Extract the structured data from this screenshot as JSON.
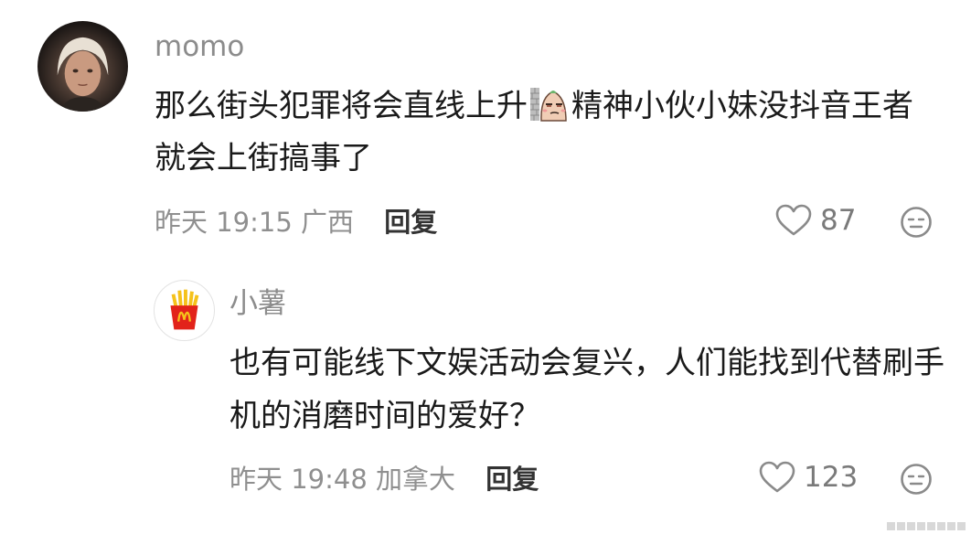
{
  "comment": {
    "username": "momo",
    "text_part1": "那么街头犯罪将会直线上升",
    "emoji": "smirk-emoji",
    "text_part2": "精神小伙小妹没抖音王者就会上街搞事了",
    "time": "昨天 19:15",
    "location": "广西",
    "reply_label": "回复",
    "likes": "87"
  },
  "reply": {
    "username": "小薯",
    "text": "也有可能线下文娱活动会复兴，人们能找到代替刷手机的消磨时间的爱好？",
    "time": "昨天 19:48",
    "location": "加拿大",
    "reply_label": "回复",
    "likes": "123"
  },
  "icons": {
    "like": "heart-outline-icon",
    "dislike": "meh-face-icon",
    "reply_avatar": "mcdonalds-fries-icon"
  },
  "colors": {
    "username": "#8c8c8c",
    "body_text": "#1a1a1a",
    "meta": "#8f8f8f",
    "fries_box": "#e2231a",
    "fries": "#f5c21b"
  }
}
